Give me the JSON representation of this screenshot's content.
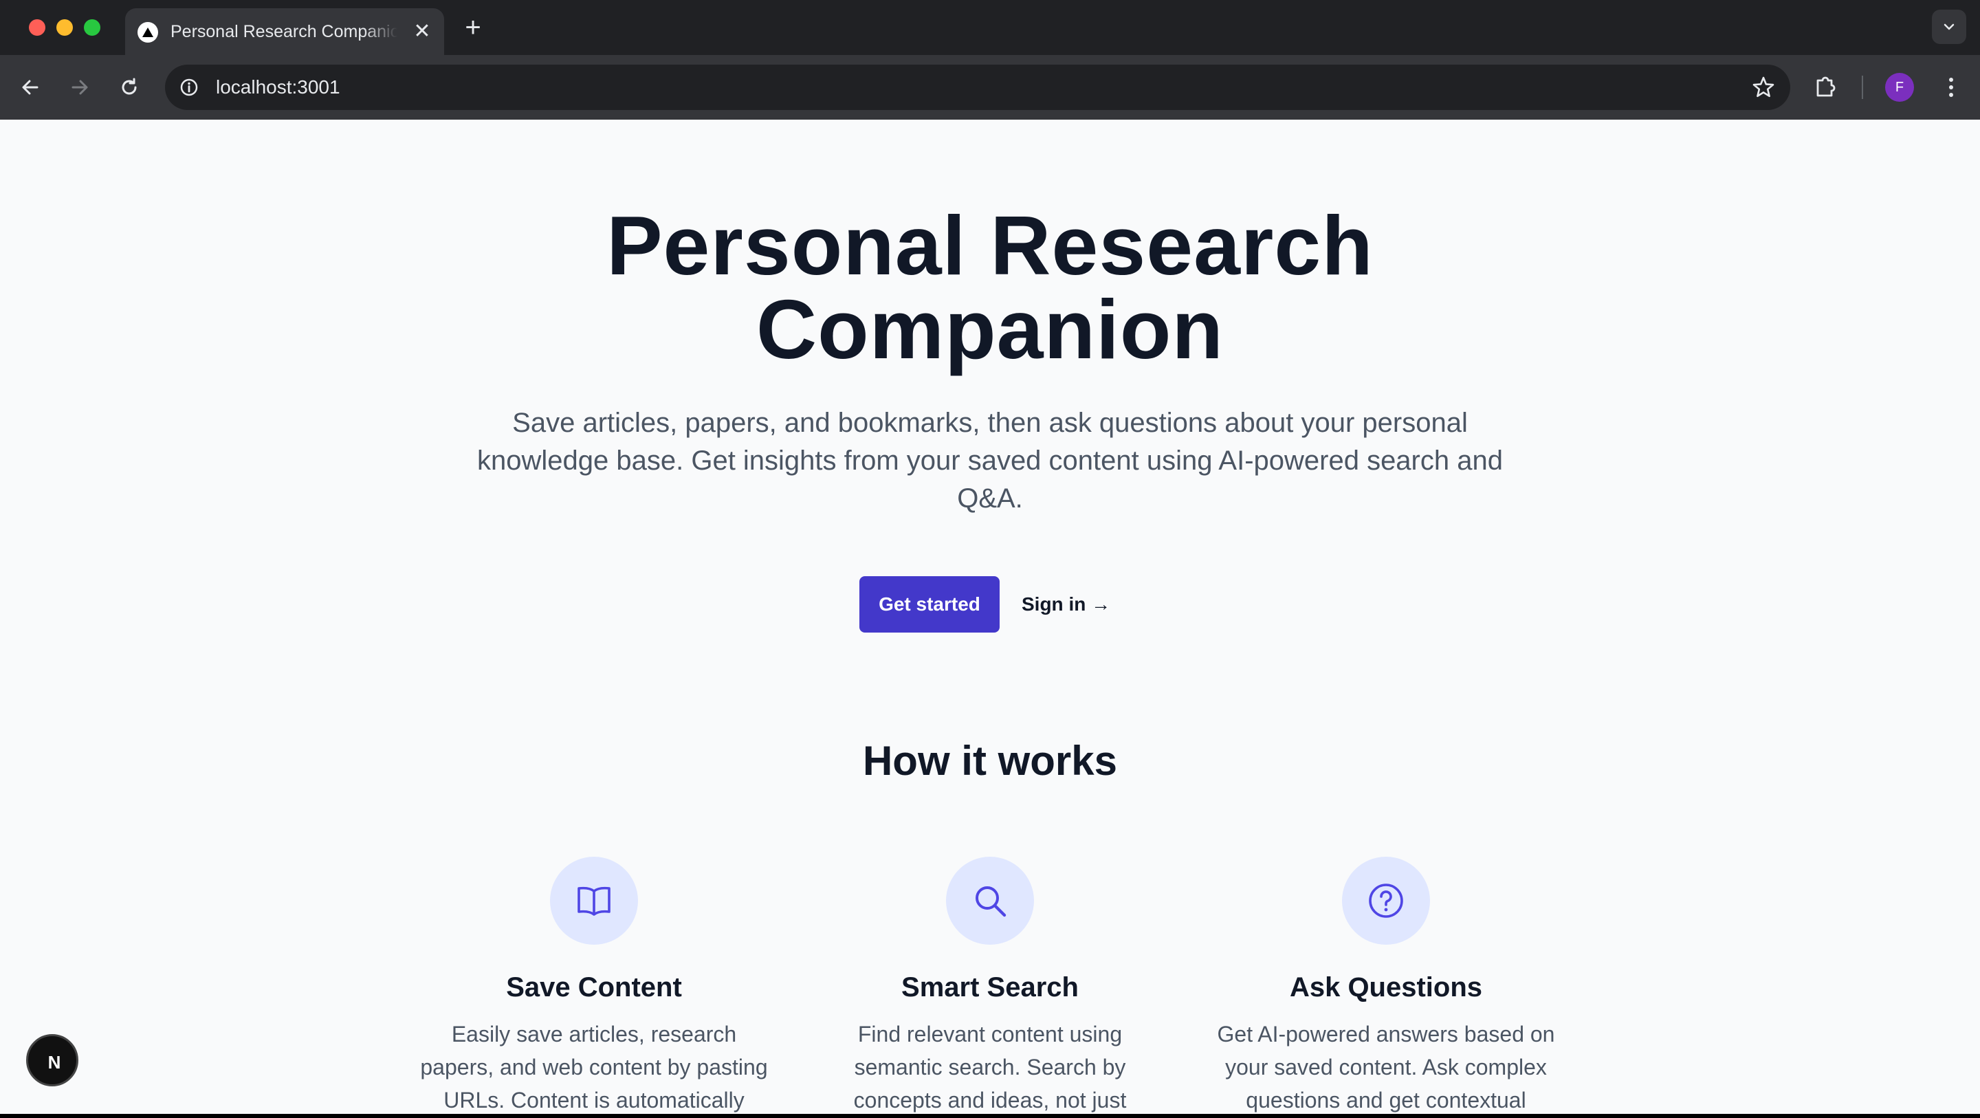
{
  "browser": {
    "tab": {
      "title": "Personal Research Companion",
      "close_glyph": "✕"
    },
    "new_tab_glyph": "+",
    "address_bar": {
      "url": "localhost:3001"
    },
    "profile_initial": "F",
    "icons": [
      "vercel-triangle-favicon",
      "chevron-down-icon",
      "back-arrow-icon",
      "forward-arrow-icon",
      "reload-icon",
      "site-info-icon",
      "star-bookmark-icon",
      "extensions-puzzle-icon",
      "kebab-menu-icon"
    ]
  },
  "hero": {
    "title_line1": "Personal Research",
    "title_line2": "Companion",
    "subtitle": "Save articles, papers, and bookmarks, then ask questions about your personal knowledge base. Get insights from your saved content using AI-powered search and Q&A.",
    "primary_cta": "Get started",
    "secondary_cta": "Sign in →"
  },
  "how_it_works": {
    "heading": "How it works",
    "features": [
      {
        "icon": "book-open-icon",
        "title": "Save Content",
        "description": "Easily save articles, research papers, and web content by pasting URLs. Content is automatically"
      },
      {
        "icon": "search-icon",
        "title": "Smart Search",
        "description": "Find relevant content using semantic search. Search by concepts and ideas, not just"
      },
      {
        "icon": "question-circle-icon",
        "title": "Ask Questions",
        "description": "Get AI-powered answers based on your saved content. Ask complex questions and get contextual"
      }
    ]
  },
  "dev_badge": {
    "label": "N"
  },
  "colors": {
    "page_background": "#f9fafb",
    "heading_text": "#111827",
    "body_text": "#4b5563",
    "primary_button": "#4338ca",
    "icon_circle": "#e0e7ff",
    "icon_stroke": "#4f46e5",
    "chrome_dark": "#202124",
    "chrome_toolbar": "#35363a"
  }
}
